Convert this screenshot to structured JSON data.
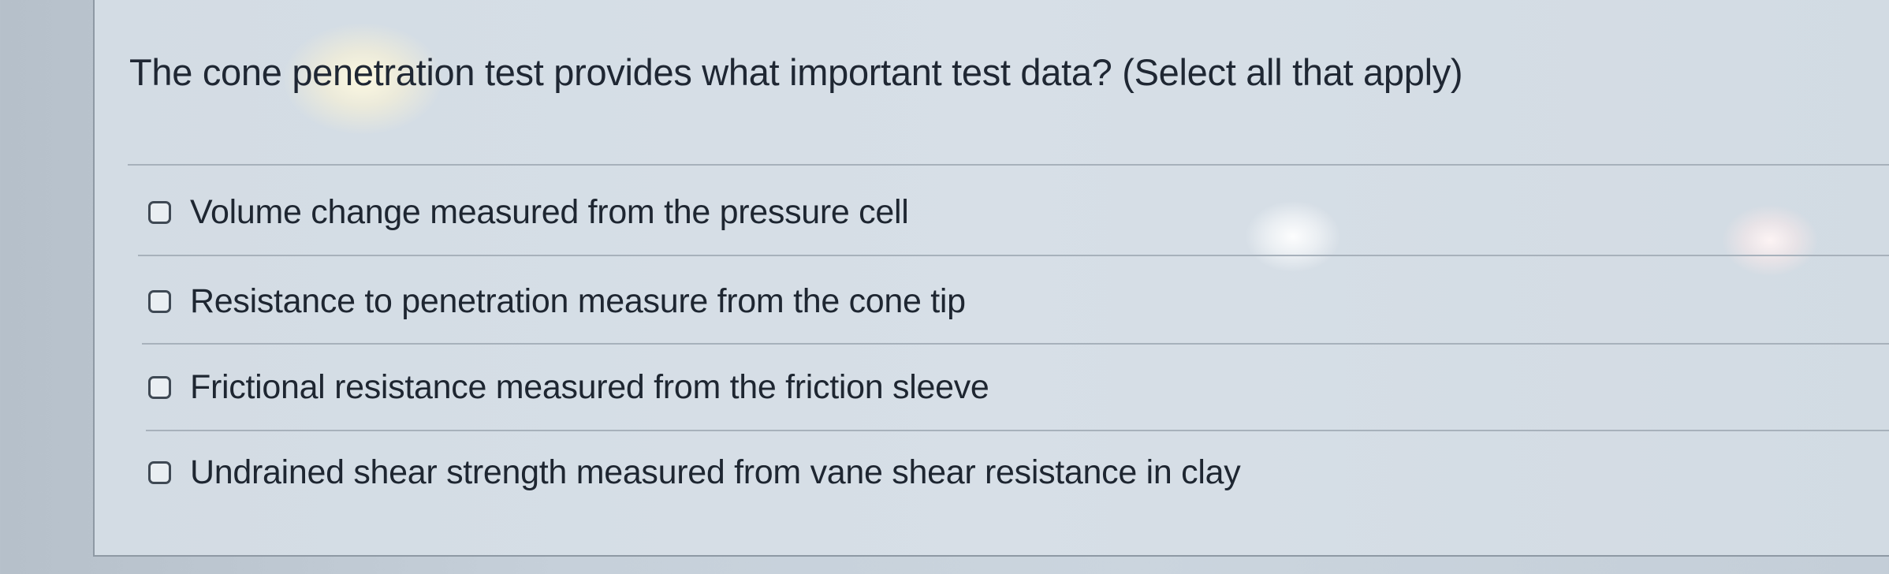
{
  "question": {
    "prompt": "The cone penetration test provides what important test data? (Select all that apply)"
  },
  "options": [
    {
      "label": "Volume change measured from the pressure cell",
      "checked": false
    },
    {
      "label": "Resistance to penetration measure from the cone tip",
      "checked": false
    },
    {
      "label": "Frictional resistance measured from the friction sleeve",
      "checked": false
    },
    {
      "label": "Undrained shear strength measured from vane shear resistance in clay",
      "checked": false
    }
  ]
}
